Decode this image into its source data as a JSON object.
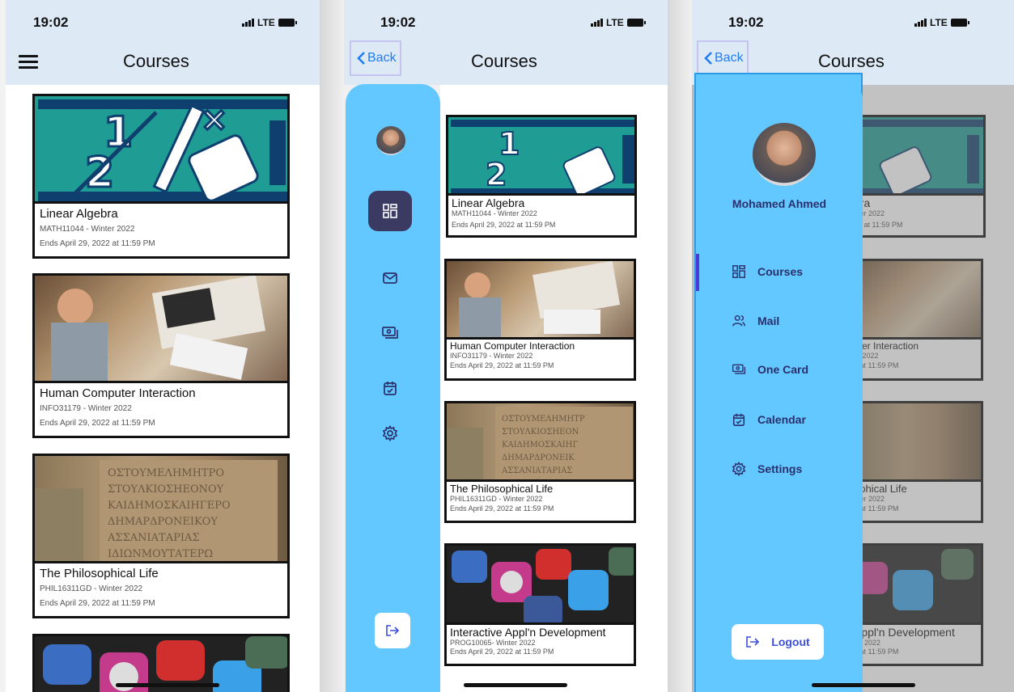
{
  "status": {
    "time": "19:02",
    "network": "LTE"
  },
  "header": {
    "title": "Courses",
    "back_label": "Back"
  },
  "courses": [
    {
      "title": "Linear Algebra",
      "code": "MATH11044 - Winter 2022",
      "ends": "Ends April 29, 2022 at 11:59 PM"
    },
    {
      "title": "Human Computer Interaction",
      "code": "INFO31179 - Winter 2022",
      "ends": "Ends April 29, 2022 at 11:59 PM"
    },
    {
      "title": "The Philosophical Life",
      "code": "PHIL16311GD - Winter 2022",
      "ends": "Ends April 29, 2022 at 11:59 PM"
    },
    {
      "title": "Interactive Appl'n Development",
      "code": "PROG10065- Winter 2022",
      "ends": "Ends April 29, 2022 at 11:59 PM"
    }
  ],
  "drawer": {
    "user_name": "Mohamed Ahmed",
    "items": [
      {
        "label": "Courses",
        "icon": "grid-icon"
      },
      {
        "label": "Mail",
        "icon": "users-icon"
      },
      {
        "label": "One Card",
        "icon": "card-icon"
      },
      {
        "label": "Calendar",
        "icon": "calendar-icon"
      },
      {
        "label": "Settings",
        "icon": "gear-icon"
      }
    ],
    "logout_label": "Logout"
  },
  "p3_partial": [
    {
      "title": "bra",
      "code": "nter 2022",
      "ends": "22 at 11:59 PM"
    },
    {
      "title": "uter Interaction",
      "code": "er 2022",
      "ends": "2 at 11:59 PM"
    },
    {
      "title": "ophical Life",
      "code": "nter 2022",
      "ends": "2 at 11:59 PM"
    },
    {
      "title": "Appl'n Development",
      "code": "ter 2022",
      "ends": "2 at 11:59 PM"
    }
  ],
  "colors": {
    "accent": "#63c8ff",
    "selected": "#3b3a63",
    "link": "#1e7cf2"
  }
}
